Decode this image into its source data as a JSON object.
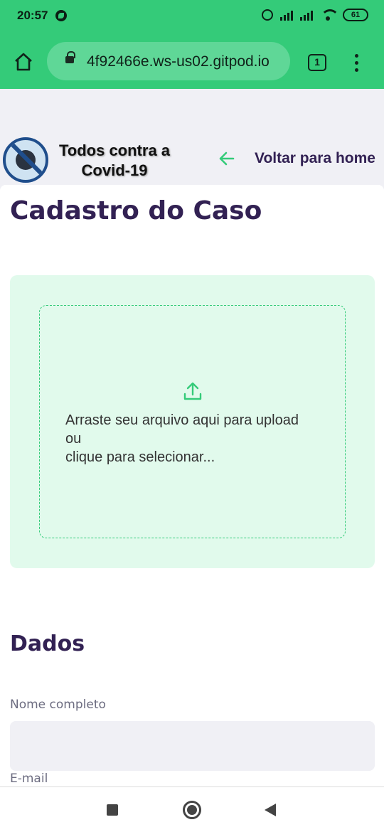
{
  "status_bar": {
    "time": "20:57",
    "battery": "61"
  },
  "browser": {
    "url": "4f92466e.ws-us02.gitpod.io",
    "tab_count": "1"
  },
  "header": {
    "logo_line1": "Todos contra a",
    "logo_line2": "Covid-19",
    "back_label": "Voltar para home"
  },
  "page": {
    "title": "Cadastro do Caso"
  },
  "dropzone": {
    "line1": "Arraste seu arquivo aqui para upload",
    "line2": "ou",
    "line3": "clique para selecionar..."
  },
  "form": {
    "section_title": "Dados",
    "name_label": "Nome completo",
    "name_value": "",
    "email_label": "E-mail"
  },
  "colors": {
    "accent": "#34cb79",
    "title": "#322153",
    "drop_bg": "#e1faec"
  }
}
